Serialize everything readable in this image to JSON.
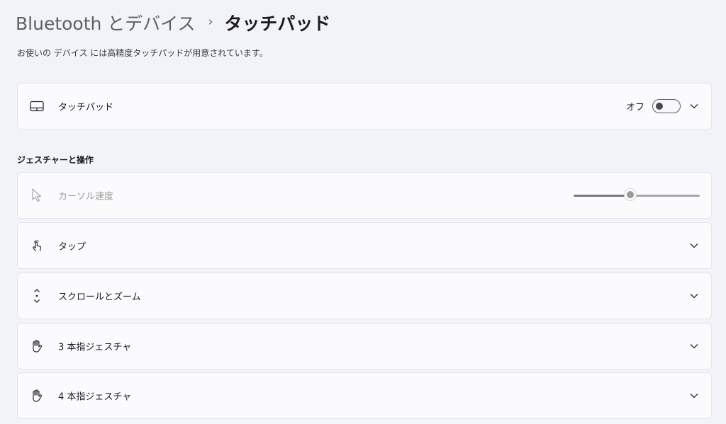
{
  "breadcrumb": {
    "parent": "Bluetooth とデバイス",
    "separator": "›",
    "current": "タッチパッド"
  },
  "description": "お使いの デバイス には高精度タッチパッドが用意されています。",
  "touchpad_card": {
    "icon": "touchpad-icon",
    "label": "タッチパッド",
    "toggle_state_label": "オフ",
    "toggle_on": false
  },
  "gestures_section": {
    "heading": "ジェスチャーと操作",
    "cursor_speed": {
      "icon": "cursor-arrow-icon",
      "label": "カーソル速度",
      "disabled": true,
      "slider_value_fraction": 0.45
    },
    "items": [
      {
        "icon": "tap-hand-icon",
        "label": "タップ"
      },
      {
        "icon": "scroll-arrows-icon",
        "label": "スクロールとズーム"
      },
      {
        "icon": "three-finger-hand-icon",
        "label": "3 本指ジェスチャ"
      },
      {
        "icon": "four-finger-hand-icon",
        "label": "4 本指ジェスチャ"
      }
    ]
  },
  "colors": {
    "background": "#f2f4f9",
    "card": "#fbfbfd",
    "text": "#1b1b1b",
    "disabled_text": "#9a9a9a"
  }
}
